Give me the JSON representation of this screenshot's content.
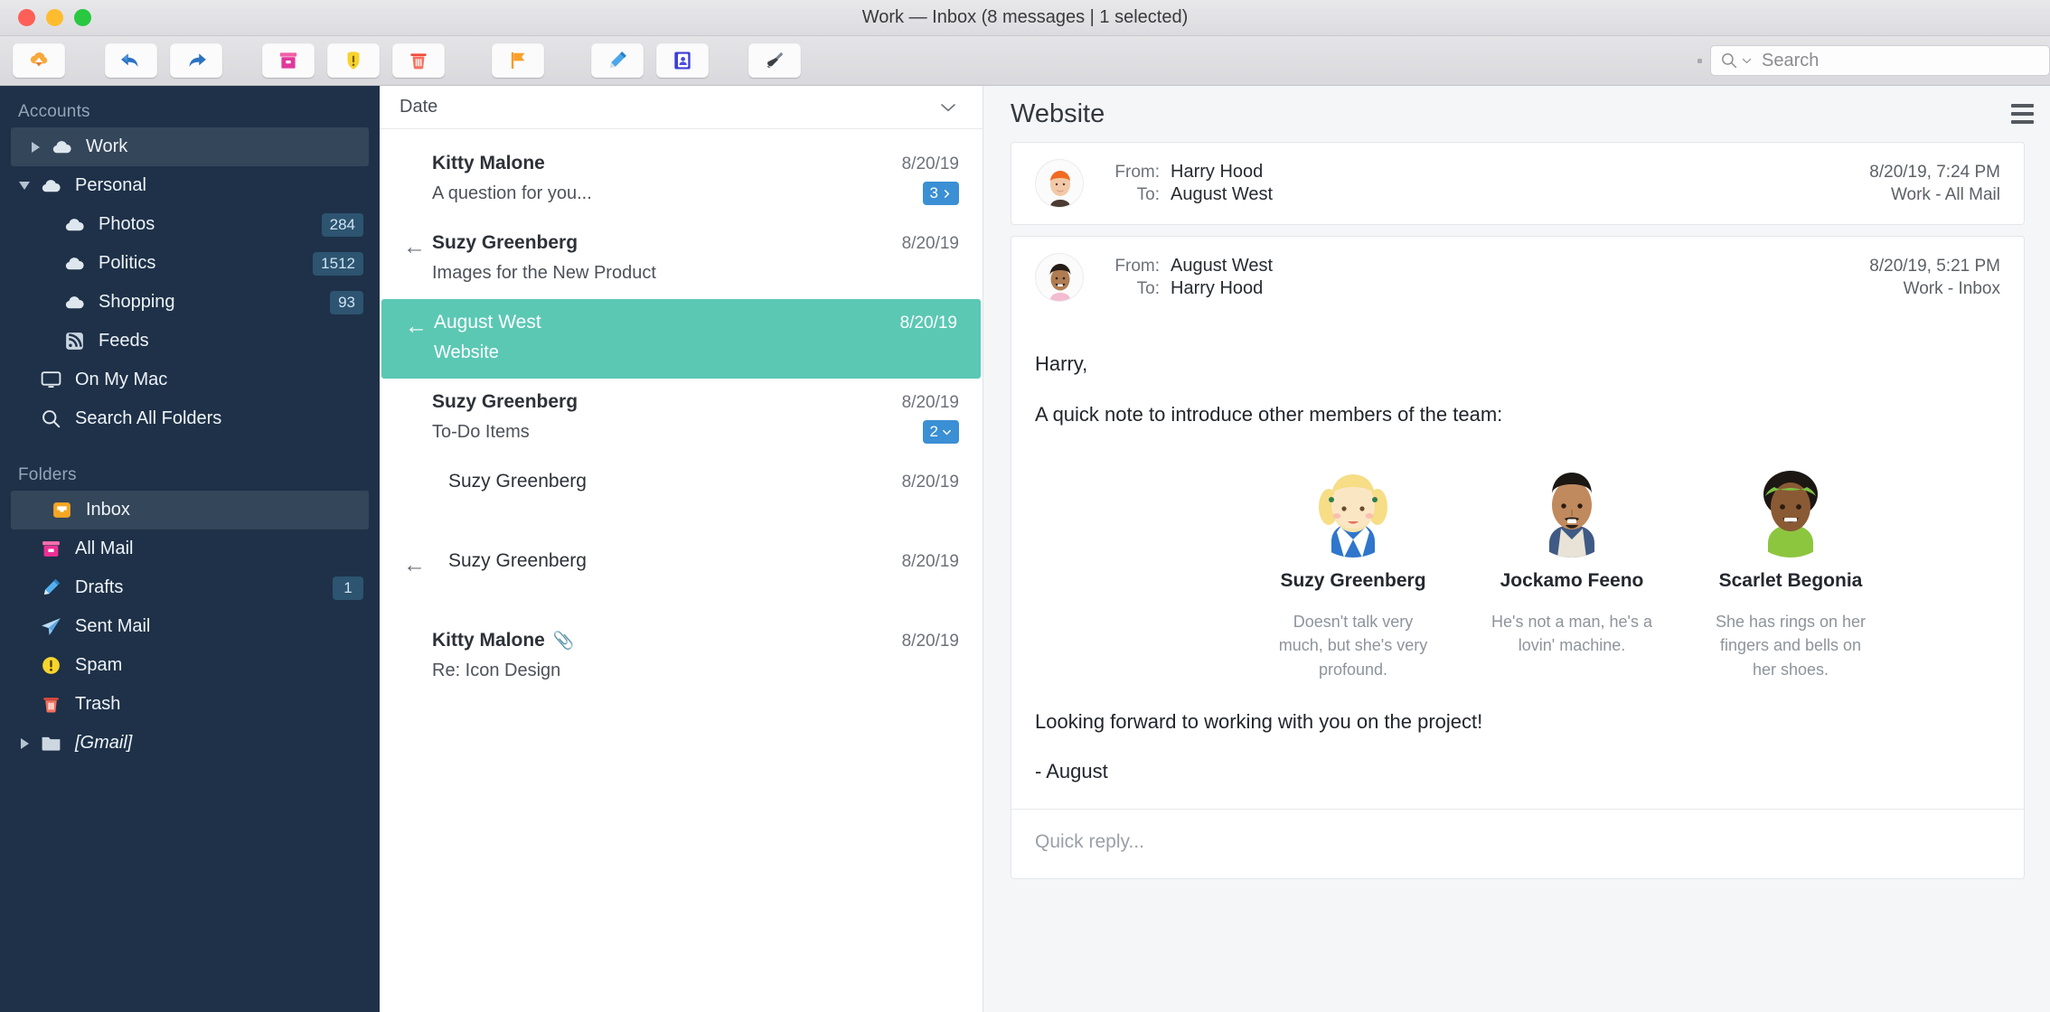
{
  "window": {
    "title": "Work — Inbox (8 messages | 1 selected)",
    "traffic_lights": [
      "close",
      "minimize",
      "zoom"
    ]
  },
  "toolbar": {
    "buttons": [
      {
        "name": "get-mail-button",
        "icon": "cloud-download-icon",
        "label": "Get Mail"
      },
      {
        "name": "reply-all-button",
        "icon": "reply-all-icon",
        "label": "Reply All"
      },
      {
        "name": "forward-button",
        "icon": "forward-arrow-icon",
        "label": "Forward"
      },
      {
        "name": "archive-button",
        "icon": "archive-box-icon",
        "label": "Archive"
      },
      {
        "name": "junk-button",
        "icon": "warning-shield-icon",
        "label": "Junk"
      },
      {
        "name": "delete-button",
        "icon": "trash-icon",
        "label": "Delete"
      },
      {
        "name": "flag-button",
        "icon": "flag-icon",
        "label": "Flag"
      },
      {
        "name": "compose-button",
        "icon": "pencil-icon",
        "label": "Compose"
      },
      {
        "name": "contacts-button",
        "icon": "address-book-icon",
        "label": "Contacts"
      },
      {
        "name": "cleanup-button",
        "icon": "brush-icon",
        "label": "Clean Up"
      }
    ],
    "search": {
      "placeholder": "Search",
      "value": "",
      "icon": "search-icon"
    }
  },
  "sidebar": {
    "accounts_header": "Accounts",
    "folders_header": "Folders",
    "accounts": [
      {
        "label": "Work",
        "icon": "cloud-icon",
        "indent": 0,
        "twisty": "right",
        "badge": "",
        "selected": true,
        "italic": false
      },
      {
        "label": "Personal",
        "icon": "cloud-icon",
        "indent": 0,
        "twisty": "down",
        "badge": "",
        "selected": false,
        "italic": false
      },
      {
        "label": "Photos",
        "icon": "cloud-icon",
        "indent": 1,
        "twisty": "",
        "badge": "284",
        "selected": false,
        "italic": false
      },
      {
        "label": "Politics",
        "icon": "cloud-icon",
        "indent": 1,
        "twisty": "",
        "badge": "1512",
        "selected": false,
        "italic": false
      },
      {
        "label": "Shopping",
        "icon": "cloud-icon",
        "indent": 1,
        "twisty": "",
        "badge": "93",
        "selected": false,
        "italic": false
      },
      {
        "label": "Feeds",
        "icon": "rss-icon",
        "indent": 1,
        "twisty": "",
        "badge": "",
        "selected": false,
        "italic": false
      },
      {
        "label": "On My Mac",
        "icon": "monitor-icon",
        "indent": 0,
        "twisty": "",
        "badge": "",
        "selected": false,
        "italic": false
      },
      {
        "label": "Search All Folders",
        "icon": "search-icon",
        "indent": 0,
        "twisty": "",
        "badge": "",
        "selected": false,
        "italic": false
      }
    ],
    "folders": [
      {
        "label": "Inbox",
        "icon": "inbox-icon",
        "indent": 0,
        "twisty": "",
        "badge": "",
        "selected": true,
        "italic": false
      },
      {
        "label": "All Mail",
        "icon": "all-mail-icon",
        "indent": 0,
        "twisty": "",
        "badge": "",
        "selected": false,
        "italic": false
      },
      {
        "label": "Drafts",
        "icon": "pencil-icon",
        "indent": 0,
        "twisty": "",
        "badge": "1",
        "selected": false,
        "italic": false
      },
      {
        "label": "Sent Mail",
        "icon": "paper-plane-icon",
        "indent": 0,
        "twisty": "",
        "badge": "",
        "selected": false,
        "italic": false
      },
      {
        "label": "Spam",
        "icon": "spam-icon",
        "indent": 0,
        "twisty": "",
        "badge": "",
        "selected": false,
        "italic": false
      },
      {
        "label": "Trash",
        "icon": "trash-icon",
        "indent": 0,
        "twisty": "",
        "badge": "",
        "selected": false,
        "italic": false
      },
      {
        "label": "[Gmail]",
        "icon": "folder-icon",
        "indent": 0,
        "twisty": "right",
        "badge": "",
        "selected": false,
        "italic": true
      }
    ]
  },
  "message_list": {
    "sort_label": "Date",
    "sort_icon": "chevron-down-icon",
    "items": [
      {
        "sender": "Kitty Malone",
        "subject": "A question for you...",
        "date": "8/20/19",
        "thread_count": "3",
        "thread_icon": "chevron-right-icon",
        "replied": false,
        "attachment": false,
        "selected": false,
        "bold": true,
        "indent": false
      },
      {
        "sender": "Suzy Greenberg",
        "subject": "Images for the New Product",
        "date": "8/20/19",
        "thread_count": "",
        "thread_icon": "",
        "replied": true,
        "attachment": false,
        "selected": false,
        "bold": true,
        "indent": false
      },
      {
        "sender": "August West",
        "subject": "Website",
        "date": "8/20/19",
        "thread_count": "",
        "thread_icon": "",
        "replied": true,
        "attachment": false,
        "selected": true,
        "bold": false,
        "indent": false
      },
      {
        "sender": "Suzy Greenberg",
        "subject": "To-Do Items",
        "date": "8/20/19",
        "thread_count": "2",
        "thread_icon": "chevron-down-icon",
        "replied": false,
        "attachment": false,
        "selected": false,
        "bold": true,
        "indent": false
      },
      {
        "sender": "Suzy Greenberg",
        "subject": "",
        "date": "8/20/19",
        "thread_count": "",
        "thread_icon": "",
        "replied": false,
        "attachment": false,
        "selected": false,
        "bold": false,
        "indent": true
      },
      {
        "sender": "Suzy Greenberg",
        "subject": "",
        "date": "8/20/19",
        "thread_count": "",
        "thread_icon": "",
        "replied": true,
        "attachment": false,
        "selected": false,
        "bold": false,
        "indent": true
      },
      {
        "sender": "Kitty Malone",
        "subject": "Re: Icon Design",
        "date": "8/20/19",
        "thread_count": "",
        "thread_icon": "",
        "replied": false,
        "attachment": true,
        "selected": false,
        "bold": true,
        "indent": false
      }
    ]
  },
  "reader": {
    "subject": "Website",
    "menu_icon": "hamburger-icon",
    "messages": [
      {
        "avatar": "harry-avatar",
        "from_label": "From:",
        "from_value": "Harry Hood",
        "to_label": "To:",
        "to_value": "August West",
        "timestamp": "8/20/19, 7:24 PM",
        "mailbox": "Work - All Mail",
        "collapsed": true
      },
      {
        "avatar": "august-avatar",
        "from_label": "From:",
        "from_value": "August West",
        "to_label": "To:",
        "to_value": "Harry Hood",
        "timestamp": "8/20/19, 5:21 PM",
        "mailbox": "Work - Inbox",
        "collapsed": false,
        "body": {
          "greeting": "Harry,",
          "intro": "A quick note to introduce other members of the team:",
          "team": [
            {
              "name": "Suzy Greenberg",
              "desc": "Doesn't talk very much, but she's very profound.",
              "avatar": "suzy-avatar"
            },
            {
              "name": "Jockamo Feeno",
              "desc": "He's not a man, he's a lovin' machine.",
              "avatar": "jockamo-avatar"
            },
            {
              "name": "Scarlet Begonia",
              "desc": "She has rings on her fingers and bells on her shoes.",
              "avatar": "scarlet-avatar"
            }
          ],
          "closing": "Looking forward to working with you on the project!",
          "signature": "- August"
        },
        "quick_reply_placeholder": "Quick reply..."
      }
    ]
  },
  "colors": {
    "sidebar_bg": "#1e3148",
    "selection_teal": "#5bc8b4",
    "badge_blue": "#3b8fd4",
    "sidebar_badge": "#2d5470"
  }
}
